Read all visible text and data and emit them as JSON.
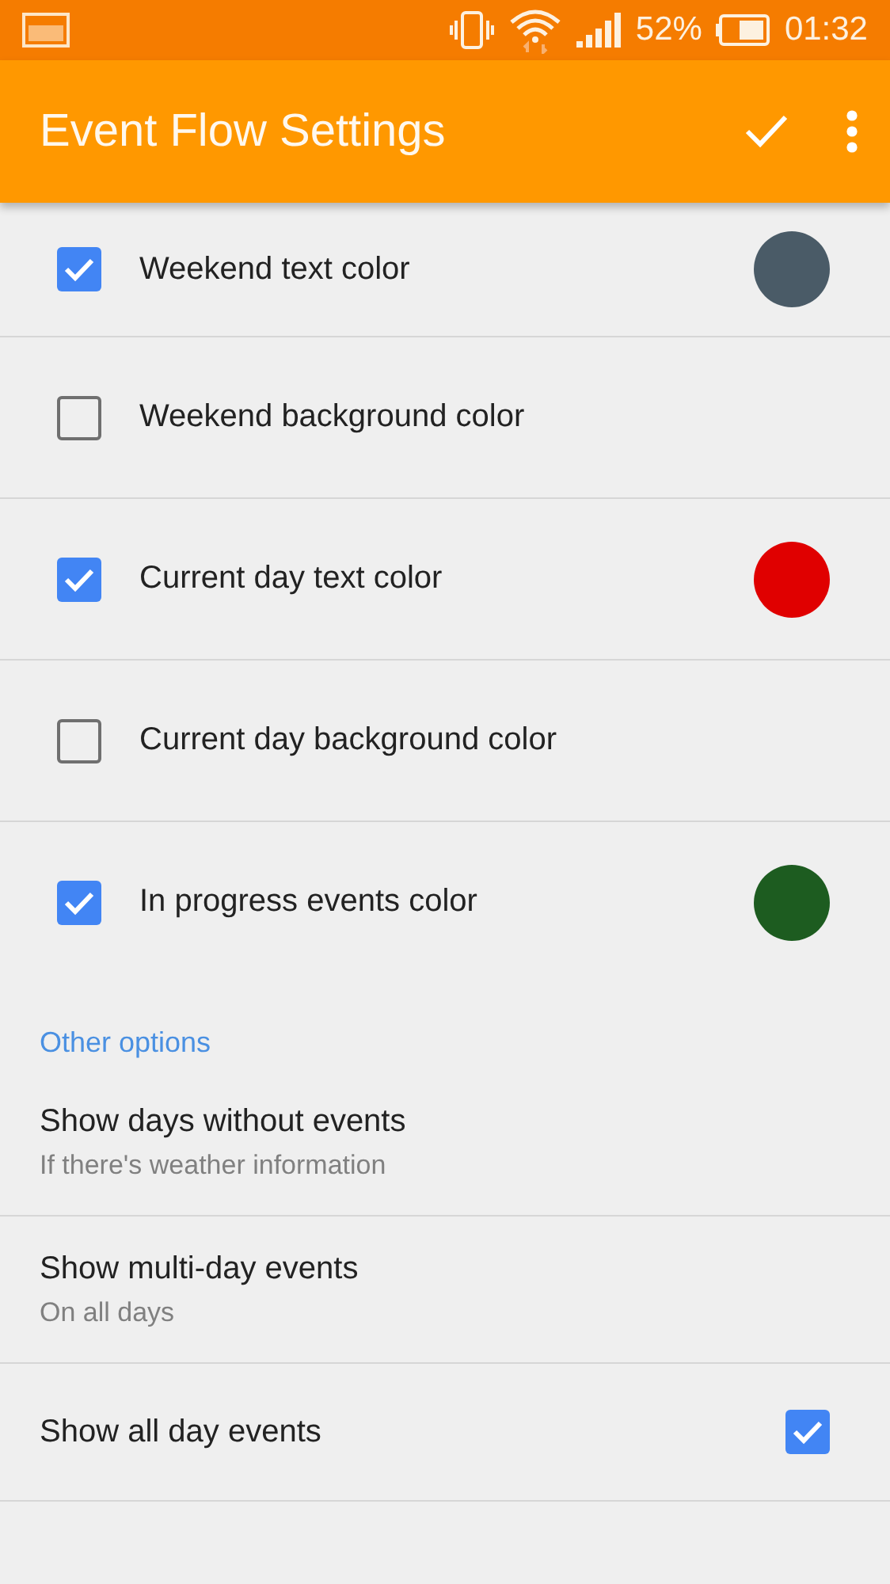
{
  "status_bar": {
    "battery": "52%",
    "time": "01:32"
  },
  "app_bar": {
    "title": "Event Flow Settings"
  },
  "color_items": [
    {
      "label": "Weekend text color",
      "checked": true,
      "color": "#4a5b67"
    },
    {
      "label": "Weekend background color",
      "checked": false
    },
    {
      "label": "Current day text color",
      "checked": true,
      "color": "#e00000"
    },
    {
      "label": "Current day background color",
      "checked": false
    },
    {
      "label": "In progress events color",
      "checked": true,
      "color": "#1d5c20"
    }
  ],
  "section": {
    "title": "Other options"
  },
  "options": [
    {
      "kind": "text",
      "title": "Show days without events",
      "summary": "If there's weather information"
    },
    {
      "kind": "text",
      "title": "Show multi-day events",
      "summary": "On all days"
    },
    {
      "kind": "checkbox",
      "title": "Show all day events",
      "checked": true
    }
  ]
}
